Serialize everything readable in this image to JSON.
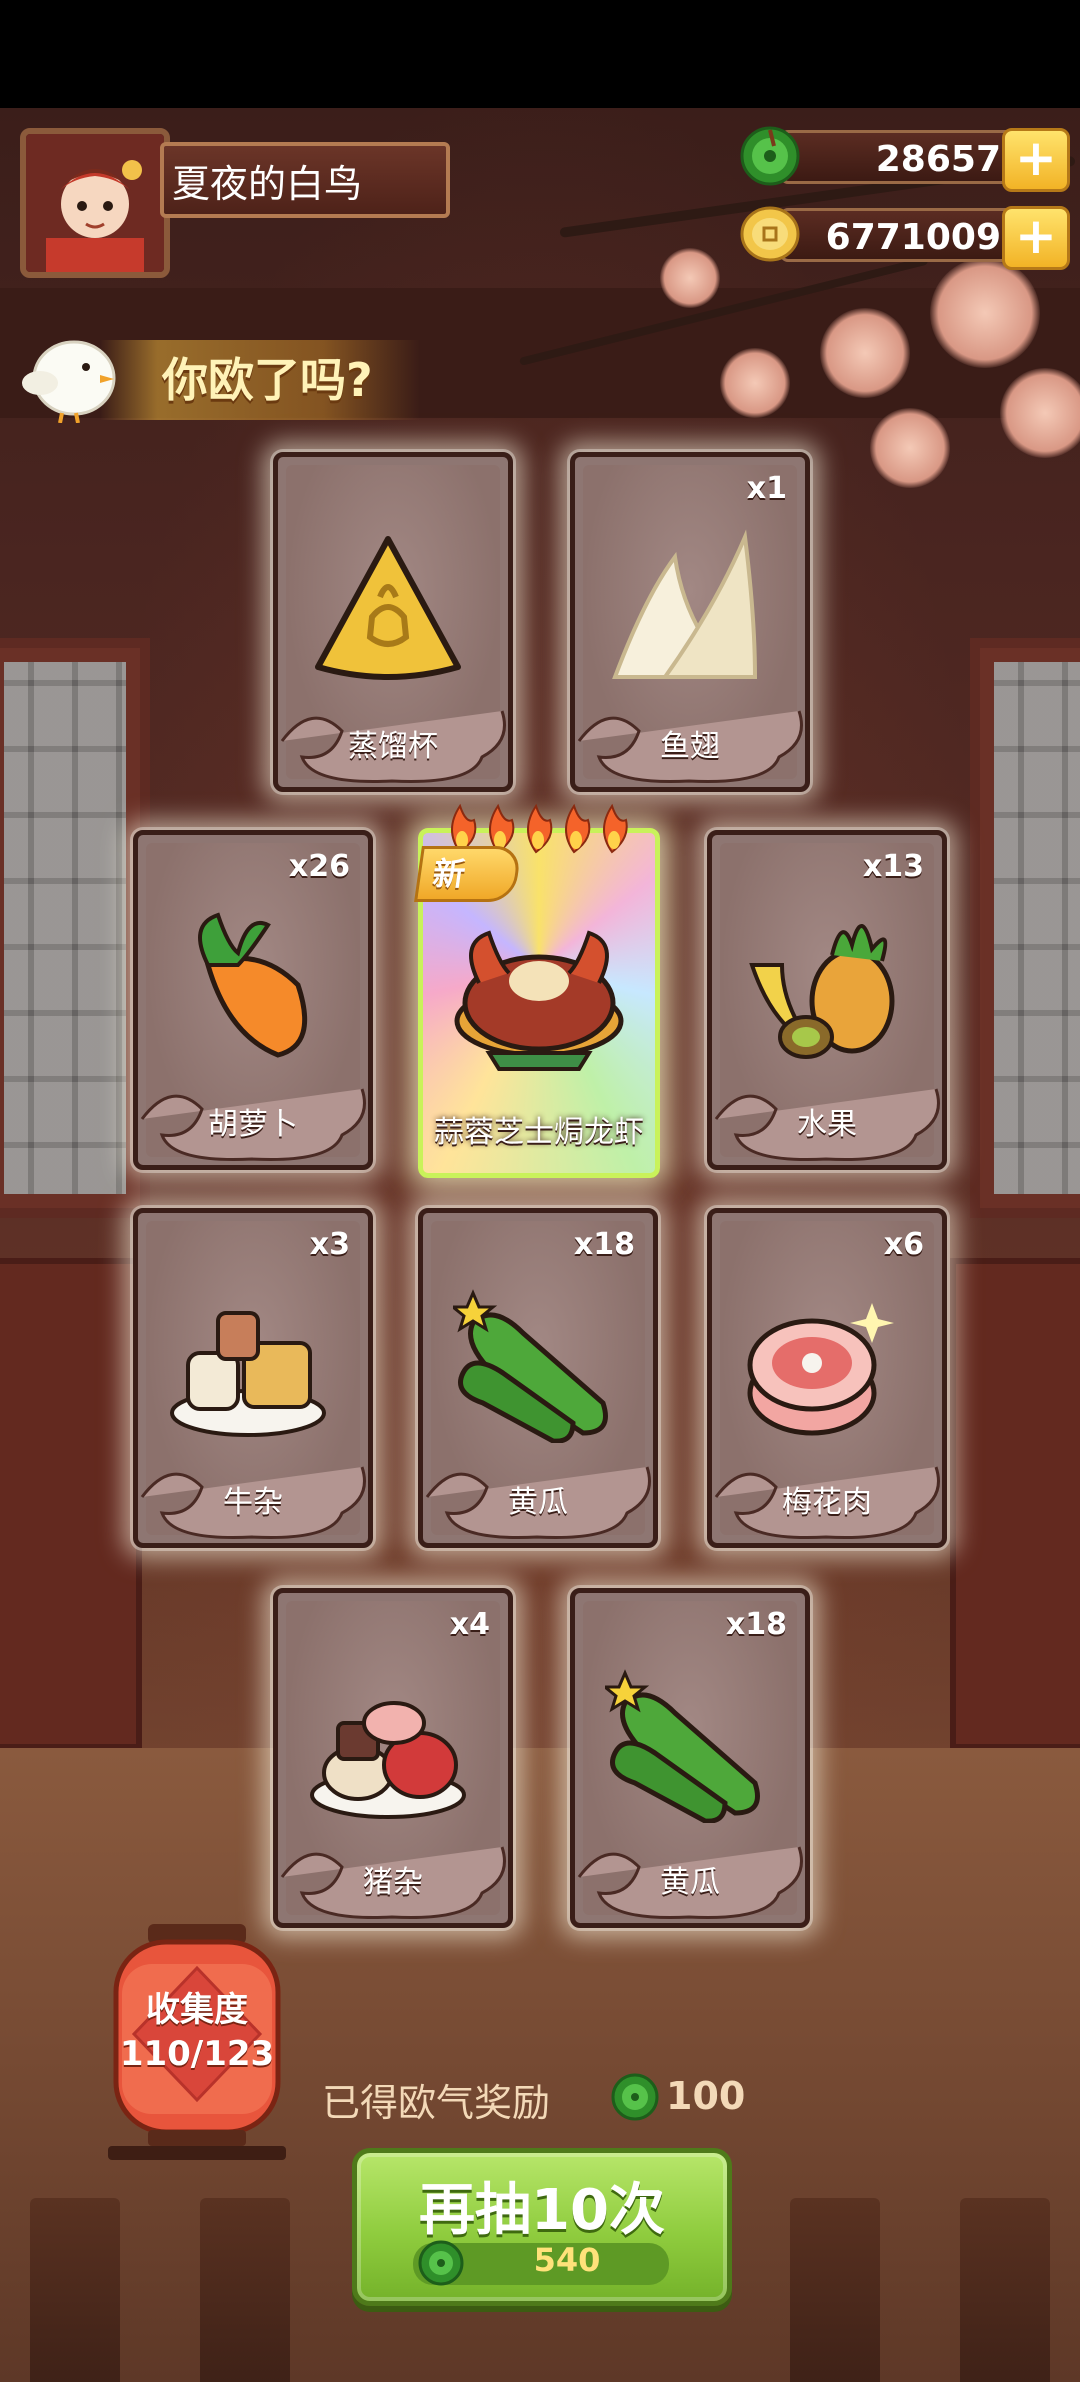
{
  "player": {
    "name": "夏夜的白鸟"
  },
  "currencies": [
    {
      "name": "jade",
      "value": "28657",
      "color": "#3aa63a"
    },
    {
      "name": "gold-coin",
      "value": "6771009",
      "color": "#e7b23a"
    }
  ],
  "banner": {
    "tagline": "你欧了吗?"
  },
  "cards": [
    {
      "name": "蒸馏杯",
      "count": "",
      "icon": "triangle-token-icon"
    },
    {
      "name": "鱼翅",
      "count": "x1",
      "icon": "shark-fin-icon"
    },
    {
      "name": "胡萝卜",
      "count": "x26",
      "icon": "carrot-icon"
    },
    {
      "name": "蒜蓉芝士焗龙虾",
      "count": "",
      "icon": "lobster-dish-icon",
      "featured": true,
      "badge": "新",
      "rating_flames": 5
    },
    {
      "name": "水果",
      "count": "x13",
      "icon": "fruit-icon"
    },
    {
      "name": "牛杂",
      "count": "x3",
      "icon": "beef-offal-icon"
    },
    {
      "name": "黄瓜",
      "count": "x18",
      "icon": "cucumber-icon"
    },
    {
      "name": "梅花肉",
      "count": "x6",
      "icon": "pork-shoulder-icon"
    },
    {
      "name": "猪杂",
      "count": "x4",
      "icon": "pork-offal-icon"
    },
    {
      "name": "黄瓜",
      "count": "x18",
      "icon": "cucumber-icon"
    }
  ],
  "collection": {
    "label": "收集度",
    "progress": "110/123"
  },
  "reward": {
    "text": "已得欧气奖励",
    "amount": "100"
  },
  "draw_again": {
    "label": "再抽10次",
    "cost": "540"
  }
}
